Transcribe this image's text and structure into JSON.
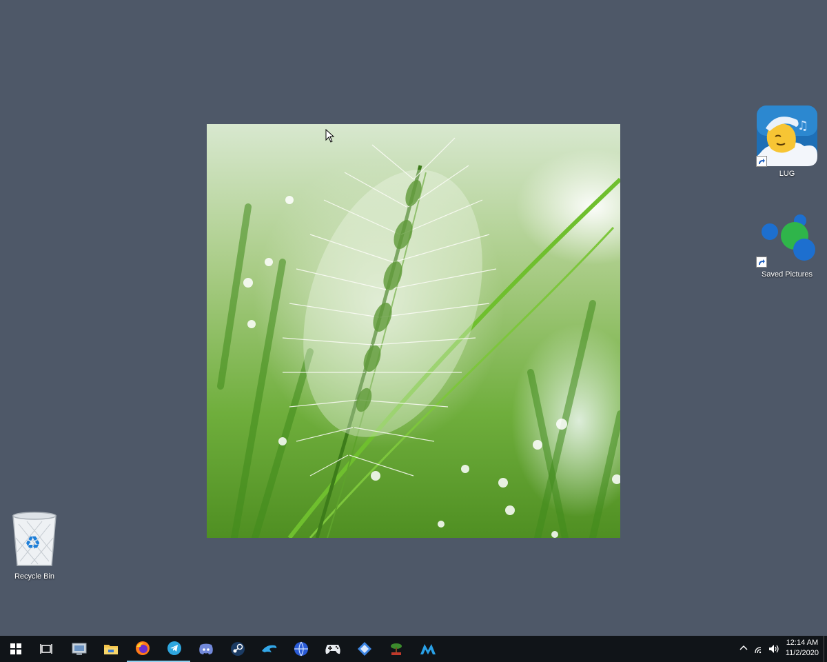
{
  "desktop": {
    "icons": [
      {
        "name": "LUG"
      },
      {
        "name": "Saved Pictures"
      },
      {
        "name": "Recycle Bin"
      }
    ]
  },
  "taskbar": {
    "apps": [
      {
        "icon": "windows-start-icon"
      },
      {
        "icon": "task-view-icon"
      },
      {
        "icon": "system-utility-icon"
      },
      {
        "icon": "file-explorer-icon"
      },
      {
        "icon": "firefox-icon",
        "active": true
      },
      {
        "icon": "telegram-icon",
        "active": true
      },
      {
        "icon": "discord-icon"
      },
      {
        "icon": "steam-icon"
      },
      {
        "icon": "dolphin-emulator-icon"
      },
      {
        "icon": "globe-app-icon"
      },
      {
        "icon": "gamepad-icon"
      },
      {
        "icon": "vpn-app-icon"
      },
      {
        "icon": "bonsai-app-icon"
      },
      {
        "icon": "m-app-icon"
      }
    ],
    "tray": {
      "time": "12:14 AM",
      "date": "11/2/2020"
    }
  },
  "colors": {
    "desktop_bg": "#4e5868",
    "taskbar_bg": "#101418",
    "active_indicator": "#8fd0ef"
  }
}
